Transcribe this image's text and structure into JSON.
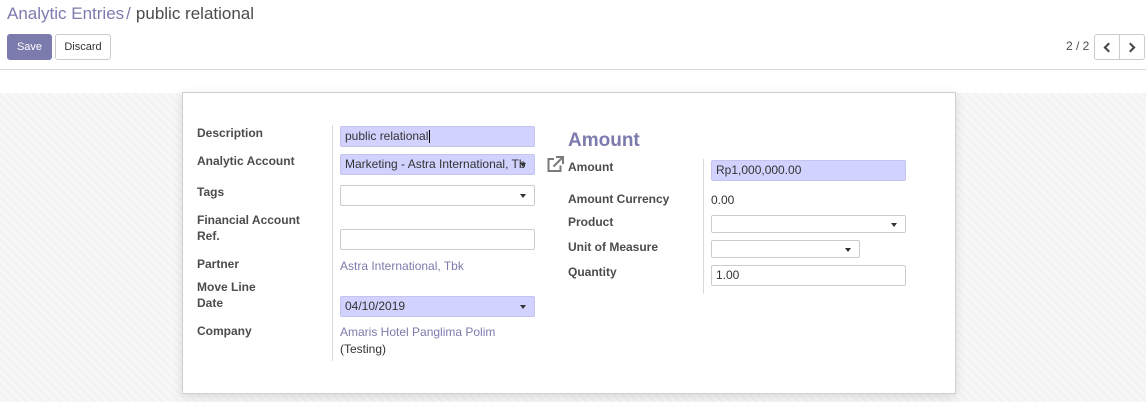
{
  "breadcrumb": {
    "parent": "Analytic Entries",
    "separator": "/",
    "current": "public relational"
  },
  "toolbar": {
    "save_label": "Save",
    "discard_label": "Discard"
  },
  "pager": {
    "value": "2 / 2"
  },
  "form": {
    "description": {
      "label": "Description",
      "value": "public relational"
    },
    "analytic_account": {
      "label": "Analytic Account",
      "value": "Marketing - Astra International, Tb"
    },
    "tags": {
      "label": "Tags",
      "value": ""
    },
    "financial_ref": {
      "label_line1": "Financial Account",
      "label_line2": "Ref.",
      "value": ""
    },
    "partner": {
      "label": "Partner",
      "value": "Astra International, Tbk"
    },
    "move_line_date": {
      "label_line1": "Move Line",
      "label_line2": "Date",
      "value": "04/10/2019"
    },
    "company": {
      "label": "Company",
      "value_line1": "Amaris Hotel Panglima Polim",
      "value_line2": "(Testing)"
    },
    "amount_group": {
      "title": "Amount",
      "amount": {
        "label": "Amount",
        "value": "Rp1,000,000.00"
      },
      "amount_currency": {
        "label": "Amount Currency",
        "value": "0.00"
      },
      "product": {
        "label": "Product",
        "value": ""
      },
      "uom": {
        "label": "Unit of Measure",
        "value": ""
      },
      "quantity": {
        "label": "Quantity",
        "value": "1.00"
      }
    }
  },
  "colors": {
    "brand": "#7c7bad",
    "required_field": "#d2d2ff"
  },
  "icons": [
    "chevron-left-icon",
    "chevron-right-icon",
    "external-link-icon",
    "dropdown-caret-icon"
  ]
}
